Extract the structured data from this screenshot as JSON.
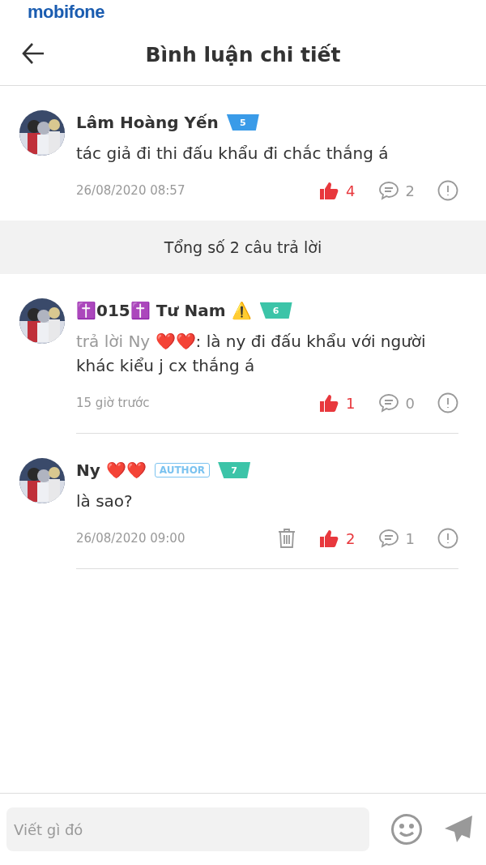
{
  "status_bar": {
    "carrier": "mobifone"
  },
  "header": {
    "title": "Bình luận chi tiết"
  },
  "comment": {
    "name": "Lâm Hoàng Yến",
    "level": "5",
    "color": "#3a9be8",
    "text": "tác giả đi thi đấu khẩu đi chắc thắng á",
    "time": "26/08/2020 08:57",
    "likes": "4",
    "liked": true,
    "replies": "2",
    "deletable": false
  },
  "reply_count": "Tổng số 2 câu trả lời",
  "replies": [
    {
      "name": "✝️015✝️ Tư Nam ⚠️",
      "author": false,
      "level": "6",
      "color": "#3cc4a8",
      "reply_to": "trả lời Ny ❤️❤️",
      "text": ": là ny đi đấu khẩu với người khác kiểu j cx thắng á",
      "time": "15 giờ trước",
      "likes": "1",
      "liked": true,
      "replies": "0",
      "deletable": false
    },
    {
      "name": "Ny ❤️❤️",
      "author": true,
      "author_label": "AUTHOR",
      "level": "7",
      "color": "#3cc4a8",
      "text": "là sao?",
      "time": "26/08/2020 09:00",
      "likes": "2",
      "liked": true,
      "replies": "1",
      "deletable": true
    }
  ],
  "composer": {
    "placeholder": "Viết gì đó"
  }
}
